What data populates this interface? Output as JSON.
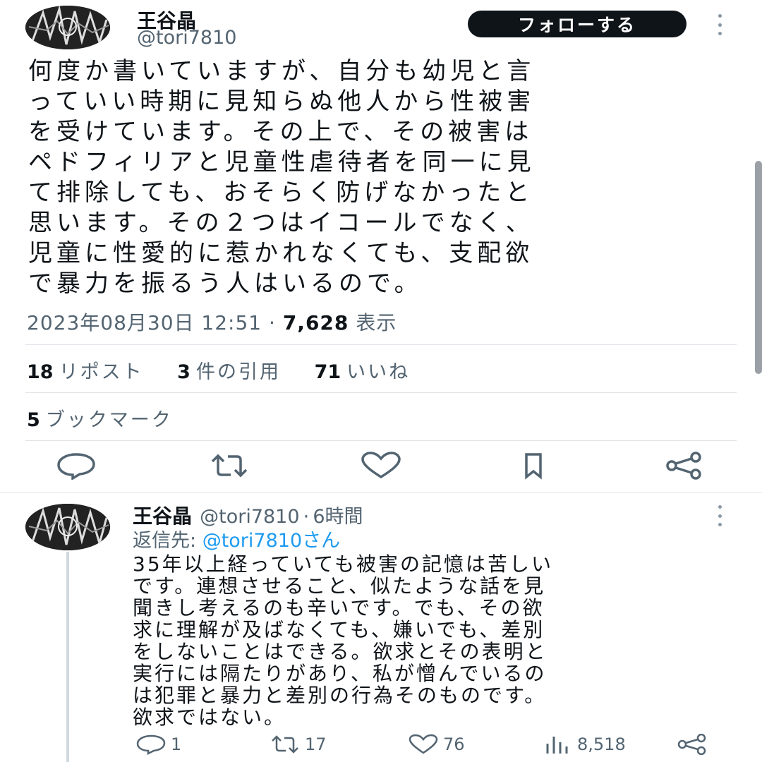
{
  "main_tweet": {
    "author_name": "王谷晶",
    "author_handle": "@tori7810",
    "follow_label": "フォローする",
    "text": "何度か書いていますが、自分も幼児と言\nっていい時期に見知らぬ他人から性被害\nを受けています。その上で、その被害は\nペドフィリアと児童性虐待者を同一に見\nて排除しても、おそらく防げなかったと\n思います。その２つはイコールでなく、\n児童に性愛的に惹かれなくても、支配欲\nで暴力を振るう人はいるので。",
    "timestamp": "2023年08月30日 12:51",
    "separator": "·",
    "views_count": "7,628",
    "views_label": "表示",
    "reposts_count": "18",
    "reposts_label": "リポスト",
    "quotes_count": "3",
    "quotes_label": "件の引用",
    "likes_count": "71",
    "likes_label": "いいね",
    "bookmarks_count": "5",
    "bookmarks_label": "ブックマーク",
    "actions": [
      "reply-icon",
      "repost-icon",
      "like-icon",
      "bookmark-icon",
      "share-icon"
    ]
  },
  "reply_tweet": {
    "author_name": "王谷晶",
    "author_handle": "@tori7810",
    "separator": "·",
    "time_ago": "6時間",
    "reply_to_label": "返信先:",
    "reply_to_mention": "@tori7810さん",
    "text": "35年以上経っていても被害の記憶は苦しい\nです。連想させること、似たような話を見\n聞きし考えるのも辛いです。でも、その欲\n求に理解が及ばなくても、嫌いでも、差別\nをしないことはできる。欲求とその表明と\n実行には隔たりがあり、私が憎んでいるの\nは犯罪と暴力と差別の行為そのものです。\n欲求ではない。",
    "reply_count": "1",
    "repost_count": "17",
    "like_count": "76",
    "views_count": "8,518"
  },
  "colors": {
    "text_primary": "#0f1419",
    "text_secondary": "#536471",
    "accent": "#1d9bf0",
    "button_bg": "#0f1419",
    "divider": "#e1e4e8"
  }
}
